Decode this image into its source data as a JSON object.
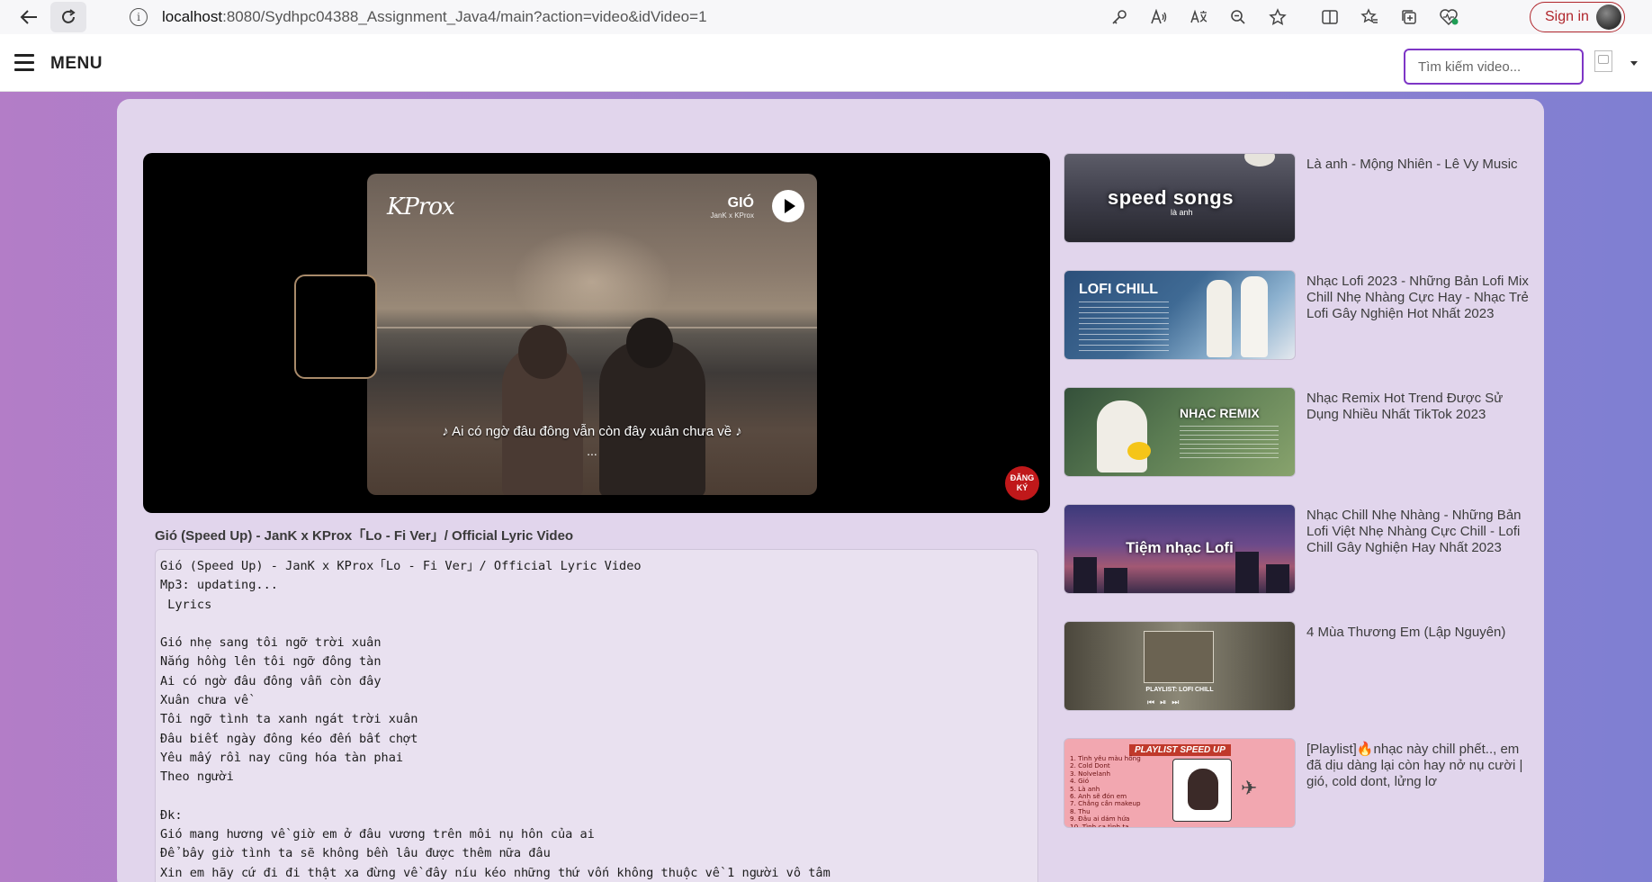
{
  "browser": {
    "url_host": "localhost",
    "url_path": ":8080/Sydhpc04388_Assignment_Java4/main?action=video&idVideo=1",
    "sign_in": "Sign in",
    "info_glyph": "i"
  },
  "header": {
    "menu_label": "MENU",
    "search_placeholder": "Tìm kiếm video..."
  },
  "player": {
    "brand_text": "KProx",
    "song_tag_title": "GIÓ",
    "song_tag_artists": "JanK x KProx",
    "overlay_lyric": "♪ Ai có ngờ đâu đông vẫn còn đây xuân chưa về ♪",
    "overlay_dots": "...",
    "subscribe_badge_line1": "ĐĂNG",
    "subscribe_badge_line2": "KÝ"
  },
  "video": {
    "title": "Gió (Speed Up) - JanK x KProx「Lo - Fi Ver」/ Official Lyric Video",
    "description": "Gió (Speed Up) - JanK x KProx「Lo - Fi Ver」/ Official Lyric Video\nMp3: updating...\n Lyrics\n\nGió nhẹ sang tôi ngỡ trời xuân\nNắng hồng lên tôi ngỡ đông tàn\nAi có ngờ đâu đông vẫn còn đây\nXuân chưa về\nTôi ngỡ tình ta xanh ngát trời xuân\nĐâu biết ngày đông kéo đến bất chợt\nYêu mấy rồi nay cũng hóa tàn phai\nTheo người\n\nĐk:\nGió mang hương về giờ em ở đâu vương trên môi nụ hôn của ai\nĐể bây giờ tình ta sẽ không bền lâu được thêm nữa đâu\nXin em hãy cứ đi đi thật xa đừng về đây níu kéo những thứ vốn không thuộc về 1 người vô tâm"
  },
  "related": [
    {
      "title": "Là anh - Mộng Nhiên - Lê Vy Music",
      "thumb_text": "speed songs",
      "thumb_sub": "là anh"
    },
    {
      "title": "Nhạc Lofi 2023 - Những Bản Lofi Mix Chill Nhẹ Nhàng Cực Hay - Nhạc Trẻ Lofi Gây Nghiện Hot Nhất 2023",
      "thumb_text": "LOFI CHILL"
    },
    {
      "title": "Nhạc Remix Hot Trend Được Sử Dụng Nhiều Nhất TikTok 2023",
      "thumb_text": "NHẠC REMIX"
    },
    {
      "title": "Nhạc Chill Nhẹ Nhàng - Những Bản Lofi Việt Nhẹ Nhàng Cực Chill - Lofi Chill Gây Nghiện Hay Nhất 2023",
      "thumb_text": "Tiệm nhạc Lofi"
    },
    {
      "title": "4 Mùa Thương Em (Lập Nguyên)",
      "thumb_text": "PLAYLIST: LOFI CHILL"
    },
    {
      "title": "[Playlist]🔥nhạc này chill phết.., em đã dịu dàng lại còn hay nở nụ cười | gió, cold dont, lửng lơ",
      "thumb_text": "PLAYLIST SPEED UP",
      "thumb_list": "1. Tình yêu màu hồng\n2. Cold Dont\n3. Nolvelanh\n4. Gió\n5. Là anh\n6. Anh sẽ đón em\n7. Chẳng cần makeup\n8. Thu\n9. Đâu ai dám hứa\n10. Tình ca tình ta"
    }
  ]
}
